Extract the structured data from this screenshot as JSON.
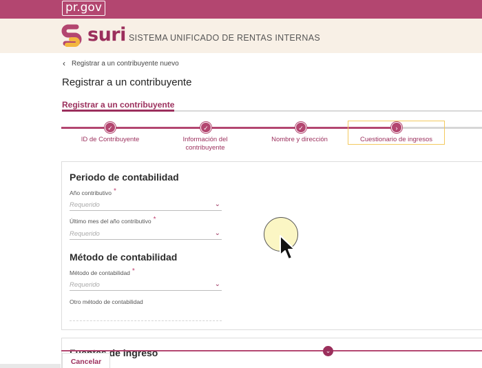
{
  "gov": {
    "logo": "pr.gov"
  },
  "header": {
    "brand": "suri",
    "subtitle": "SISTEMA UNIFICADO DE RENTAS INTERNAS"
  },
  "breadcrumb": {
    "back_label": "Registrar a un contribuyente nuevo"
  },
  "page_title": "Registrar a un contribuyente",
  "tabs": [
    {
      "label": "Registrar a un contribuyente",
      "active": true
    }
  ],
  "stepper": {
    "steps": [
      {
        "label": "ID de Contribuyente",
        "state": "done"
      },
      {
        "label": "Información del contribuyente",
        "state": "done"
      },
      {
        "label": "Nombre y dirección",
        "state": "done"
      },
      {
        "label": "Cuestionario de ingresos",
        "state": "current"
      }
    ]
  },
  "form": {
    "section1_title": "Periodo de contabilidad",
    "field_year_label": "Año contributivo",
    "field_year_placeholder": "Requerido",
    "field_month_label": "Último mes del año contributivo",
    "field_month_placeholder": "Requerido",
    "section2_title": "Método de contabilidad",
    "field_method_label": "Método de contabilidad",
    "field_method_placeholder": "Requerido",
    "field_other_label": "Otro método de contabilidad",
    "required_mark": "*"
  },
  "next_section_title": "Fuentes de ingreso",
  "actions": {
    "cancel_label": "Cancelar"
  },
  "colors": {
    "brand": "#b34670",
    "brand_dark": "#9b2f5c",
    "header_bg": "#f8f0e6",
    "highlight": "#f3c95d"
  },
  "icons": {
    "back": "chevron-left-icon",
    "check": "check-icon",
    "current": "chevron-right-icon",
    "dropdown": "chevron-down-icon",
    "cursor": "mouse-pointer-icon",
    "expand": "chevron-down-icon"
  }
}
